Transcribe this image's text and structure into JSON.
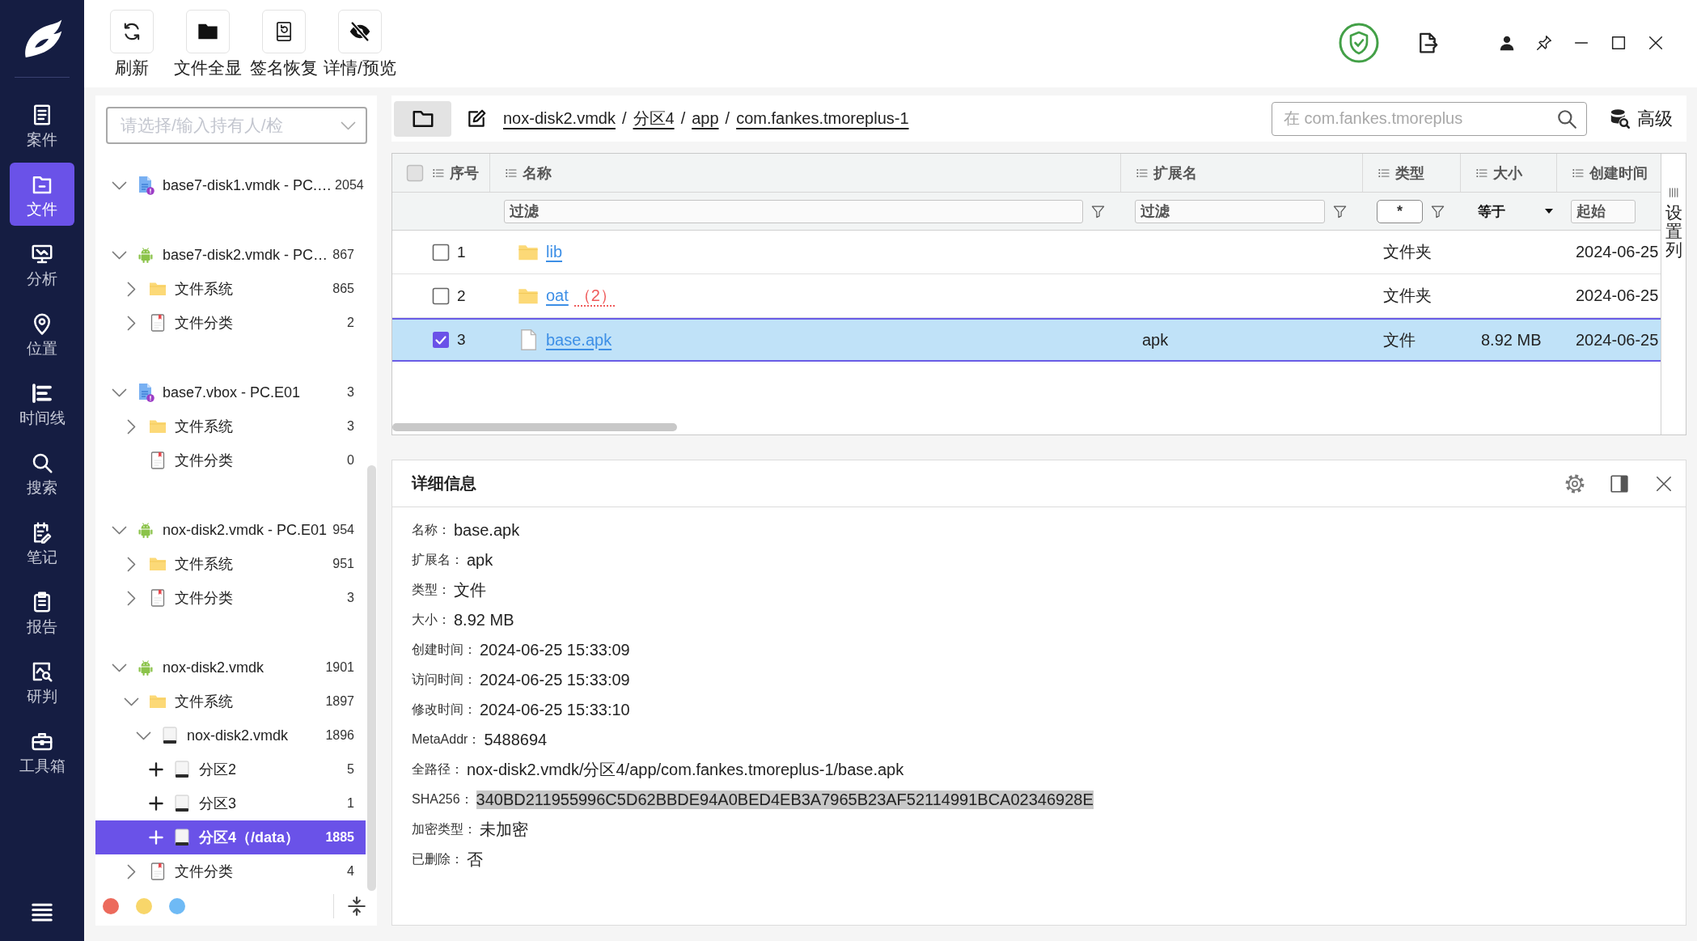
{
  "nav": {
    "items": [
      {
        "label": "案件",
        "selected": false
      },
      {
        "label": "文件",
        "selected": true
      },
      {
        "label": "分析",
        "selected": false
      },
      {
        "label": "位置",
        "selected": false
      },
      {
        "label": "时间线",
        "selected": false
      },
      {
        "label": "搜索",
        "selected": false
      },
      {
        "label": "笔记",
        "selected": false
      },
      {
        "label": "报告",
        "selected": false
      },
      {
        "label": "研判",
        "selected": false
      },
      {
        "label": "工具箱",
        "selected": false
      }
    ]
  },
  "toolbar": {
    "buttons": [
      {
        "label": "刷新"
      },
      {
        "label": "文件全显"
      },
      {
        "label": "签名恢复"
      },
      {
        "label": "详情/预览"
      }
    ]
  },
  "tree": {
    "placeholder": "请选择/输入持有人/检",
    "items": [
      {
        "kind": "image",
        "label": "base7-disk1.vmdk - PC.…",
        "count": "2054",
        "expandable": true,
        "expanded": true,
        "selected": false
      },
      {
        "kind": "android",
        "label": "base7-disk2.vmdk - PC…",
        "count": "867",
        "expandable": true,
        "expanded": true,
        "selected": false,
        "children": [
          {
            "kind": "folder",
            "label": "文件系统",
            "count": "865",
            "expandable": true,
            "expanded": false,
            "selected": false
          },
          {
            "kind": "category",
            "label": "文件分类",
            "count": "2",
            "expandable": true,
            "expanded": false,
            "selected": false
          }
        ]
      },
      {
        "kind": "image",
        "label": "base7.vbox - PC.E01",
        "count": "3",
        "expandable": true,
        "expanded": true,
        "selected": false,
        "children": [
          {
            "kind": "folder",
            "label": "文件系统",
            "count": "3",
            "expandable": true,
            "expanded": false,
            "selected": false
          },
          {
            "kind": "category",
            "label": "文件分类",
            "count": "0",
            "expandable": false,
            "selected": false
          }
        ]
      },
      {
        "kind": "android",
        "label": "nox-disk2.vmdk - PC.E01",
        "count": "954",
        "expandable": true,
        "expanded": true,
        "selected": false,
        "children": [
          {
            "kind": "folder",
            "label": "文件系统",
            "count": "951",
            "expandable": true,
            "expanded": false,
            "selected": false
          },
          {
            "kind": "category",
            "label": "文件分类",
            "count": "3",
            "expandable": true,
            "expanded": false,
            "selected": false
          }
        ]
      },
      {
        "kind": "android",
        "label": "nox-disk2.vmdk",
        "count": "1901",
        "expandable": true,
        "expanded": true,
        "selected": false,
        "children": [
          {
            "kind": "folder",
            "label": "文件系统",
            "count": "1897",
            "expandable": true,
            "expanded": true,
            "selected": false,
            "children": [
              {
                "kind": "disk",
                "label": "nox-disk2.vmdk",
                "count": "1896",
                "expandable": true,
                "expanded": true,
                "selected": false,
                "children": [
                  {
                    "kind": "partition",
                    "label": "分区2",
                    "count": "5",
                    "expandable": true,
                    "expanded": false,
                    "selected": false
                  },
                  {
                    "kind": "partition",
                    "label": "分区3",
                    "count": "1",
                    "expandable": true,
                    "expanded": false,
                    "selected": false
                  },
                  {
                    "kind": "partition",
                    "label": "分区4（/data）",
                    "count": "1885",
                    "expandable": true,
                    "expanded": false,
                    "selected": true
                  }
                ]
              }
            ]
          },
          {
            "kind": "category",
            "label": "文件分类",
            "count": "4",
            "expandable": true,
            "expanded": false,
            "selected": false
          }
        ]
      }
    ],
    "tags": [
      {
        "color": "#ec6a5c"
      },
      {
        "color": "#f8d66a"
      },
      {
        "color": "#6fbaf5"
      }
    ]
  },
  "breadcrumb": {
    "items": [
      {
        "label": "nox-disk2.vmdk"
      },
      {
        "separator": "/",
        "label": "分区4"
      },
      {
        "separator": "/",
        "label": "app"
      },
      {
        "separator": "/",
        "label": "com.fankes.tmoreplus-1"
      }
    ]
  },
  "search": {
    "placeholder": "在 com.fankes.tmoreplus",
    "advanced_label": "高级"
  },
  "table": {
    "select_all": {
      "checked": false
    },
    "columns": [
      {
        "label": "序号"
      },
      {
        "label": "名称",
        "filter": {
          "kind": "text",
          "placeholder": "过滤"
        }
      },
      {
        "label": "扩展名",
        "filter": {
          "kind": "text",
          "placeholder": "过滤"
        }
      },
      {
        "label": "类型",
        "filter": {
          "kind": "text",
          "value": "*"
        }
      },
      {
        "label": "大小",
        "filter": {
          "kind": "select",
          "value": "等于"
        }
      },
      {
        "label": "创建时间",
        "filter": {
          "kind": "range",
          "placeholder": "起始"
        }
      }
    ],
    "rows": [
      {
        "index": "1",
        "kind": "folder",
        "name": "lib",
        "type": "文件夹",
        "created": "2024-06-25",
        "checked": false,
        "selected": false
      },
      {
        "index": "2",
        "kind": "folder",
        "name": "oat",
        "badge": "（2）",
        "type": "文件夹",
        "created": "2024-06-25",
        "checked": false,
        "selected": false
      },
      {
        "index": "3",
        "kind": "file",
        "name": "base.apk",
        "extension": "apk",
        "type": "文件",
        "size": "8.92 MB",
        "created": "2024-06-25",
        "checked": true,
        "selected": true
      }
    ],
    "column_settings": {
      "label": "设置列"
    }
  },
  "details": {
    "title": "详细信息",
    "fields": [
      {
        "label": "名称：",
        "value": "base.apk",
        "highlighted": false
      },
      {
        "label": "扩展名：",
        "value": "apk",
        "highlighted": false
      },
      {
        "label": "类型：",
        "value": "文件",
        "highlighted": false
      },
      {
        "label": "大小：",
        "value": "8.92 MB",
        "highlighted": false
      },
      {
        "label": "创建时间：",
        "value": "2024-06-25 15:33:09",
        "highlighted": false
      },
      {
        "label": "访问时间：",
        "value": "2024-06-25 15:33:09",
        "highlighted": false
      },
      {
        "label": "修改时间：",
        "value": "2024-06-25 15:33:10",
        "highlighted": false
      },
      {
        "label": "MetaAddr：",
        "value": "5488694",
        "highlighted": false
      },
      {
        "label": "全路径：",
        "value": "nox-disk2.vmdk/分区4/app/com.fankes.tmoreplus-1/base.apk",
        "highlighted": false
      },
      {
        "label": "SHA256：",
        "value": "340BD211955996C5D62BBDE94A0BED4EB3A7965B23AF52114991BCA02346928E",
        "highlighted": true
      },
      {
        "label": "加密类型：",
        "value": "未加密",
        "highlighted": false
      },
      {
        "label": "已删除：",
        "value": "否",
        "highlighted": false
      }
    ]
  }
}
